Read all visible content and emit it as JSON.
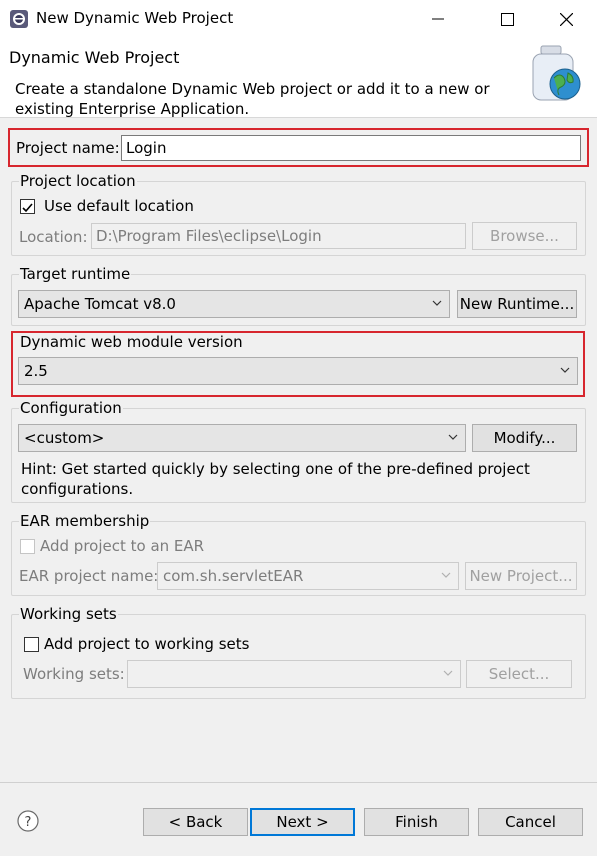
{
  "window": {
    "title": "New Dynamic Web Project",
    "icons": {
      "app": "eclipse-icon",
      "minimize": "minimize-icon",
      "maximize": "maximize-icon",
      "close": "close-icon"
    }
  },
  "banner": {
    "title": "Dynamic Web Project",
    "description": "Create a standalone Dynamic Web project or add it to a new or existing Enterprise Application.",
    "icon": "web-project-jar-globe-icon"
  },
  "project_name": {
    "label": "Project name:",
    "value": "Login"
  },
  "project_location": {
    "legend": "Project location",
    "use_default_label": "Use default location",
    "use_default_checked": true,
    "location_label": "Location:",
    "location_value": "D:\\Program Files\\eclipse\\Login",
    "browse_label": "Browse..."
  },
  "target_runtime": {
    "legend": "Target runtime",
    "value": "Apache Tomcat v8.0",
    "new_runtime_label": "New Runtime..."
  },
  "module_version": {
    "legend": "Dynamic web module version",
    "value": "2.5"
  },
  "configuration": {
    "legend": "Configuration",
    "value": "<custom>",
    "modify_label": "Modify...",
    "hint": "Hint: Get started quickly by selecting one of the pre-defined project configurations."
  },
  "ear": {
    "legend": "EAR membership",
    "add_label": "Add project to an EAR",
    "add_checked": false,
    "name_label": "EAR project name:",
    "name_value": "com.sh.servletEAR",
    "new_project_label": "New Project..."
  },
  "working_sets": {
    "legend": "Working sets",
    "add_label": "Add project to working sets",
    "add_checked": false,
    "sets_label": "Working sets:",
    "sets_value": "",
    "select_label": "Select..."
  },
  "footer": {
    "help_icon": "help-icon",
    "back_label": "< Back",
    "next_label": "Next >",
    "finish_label": "Finish",
    "cancel_label": "Cancel"
  },
  "highlight_color": "#d7262e"
}
